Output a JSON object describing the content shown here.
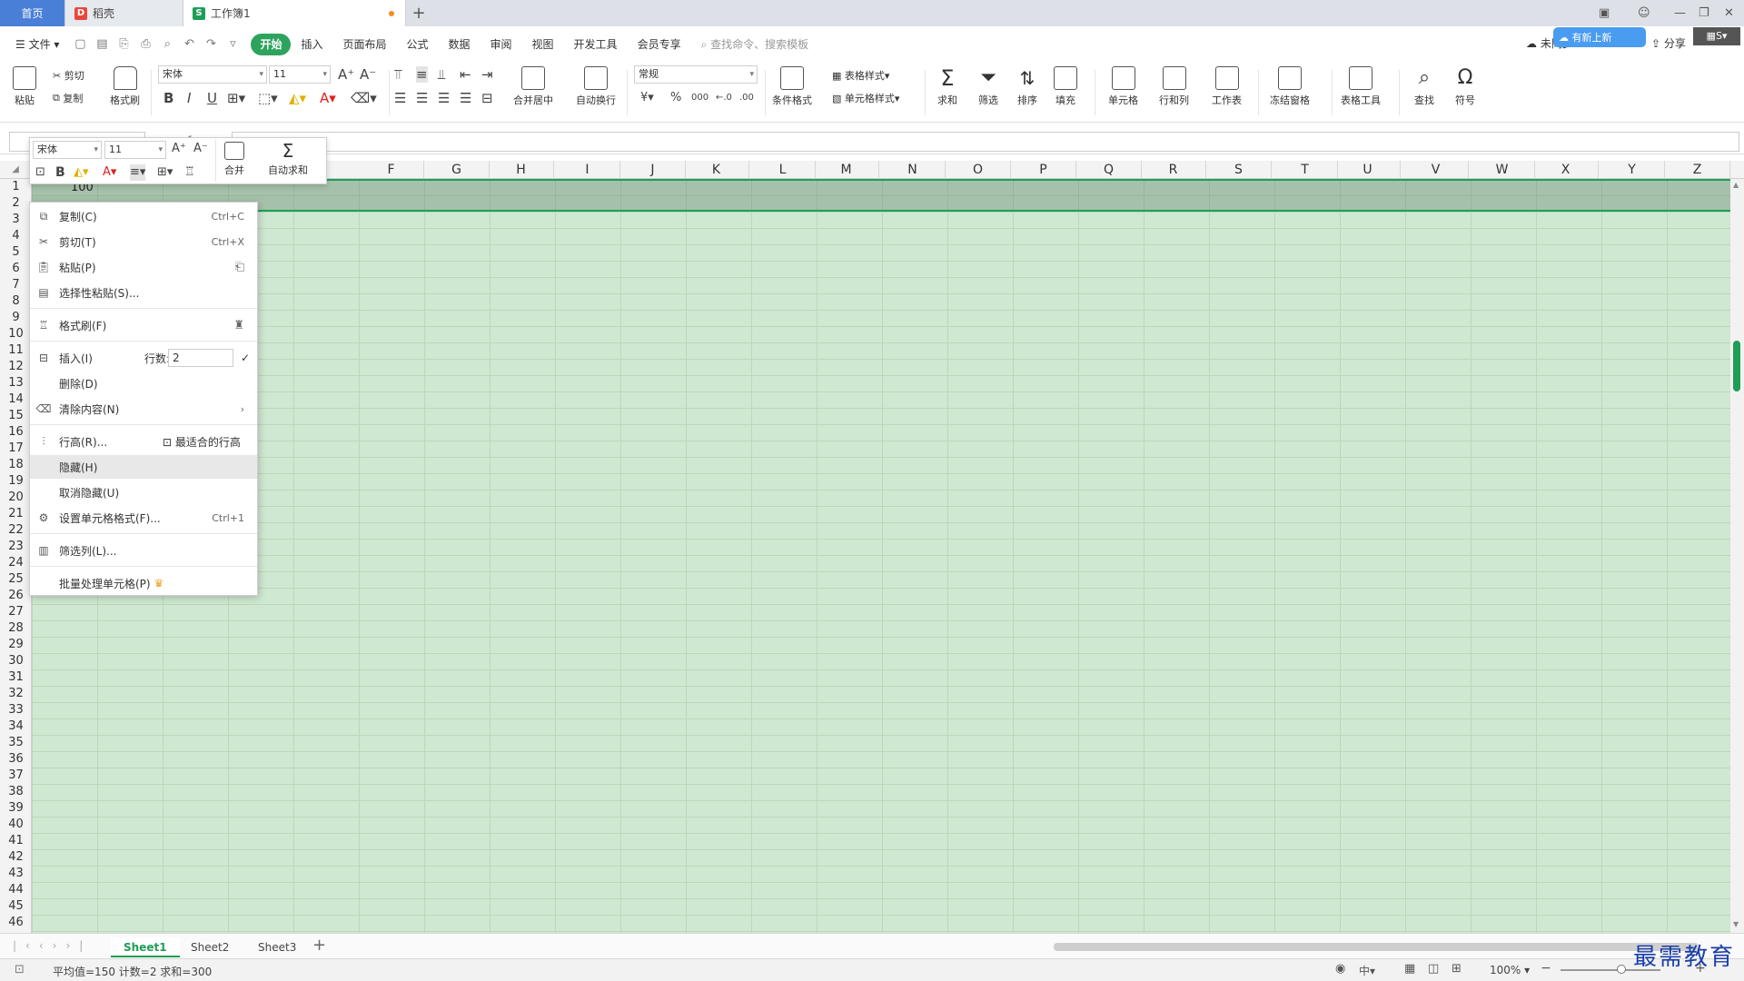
{
  "tabs": {
    "home": "首页",
    "daoke": "稻壳",
    "workbook": "工作簿1",
    "add": "+"
  },
  "menu": {
    "file": "文件",
    "items": [
      "开始",
      "插入",
      "页面布局",
      "公式",
      "数据",
      "审阅",
      "视图",
      "开发工具",
      "会员专享"
    ],
    "search_placeholder": "查找命令、搜索模板",
    "cloud": "未同步",
    "share": "分享",
    "cloud_badge": "有新上新"
  },
  "ribbon": {
    "paste": "粘贴",
    "cut": "剪切",
    "copy": "复制",
    "format_painter": "格式刷",
    "font": "宋体",
    "size": "11",
    "merge": "合并居中",
    "wrap": "自动换行",
    "number_format": "常规",
    "table_style": "表格样式",
    "cond_format": "条件格式",
    "cell_style": "单元格样式",
    "sum": "求和",
    "filter": "筛选",
    "sort": "排序",
    "fill": "填充",
    "cell": "单元格",
    "rowcol": "行和列",
    "sheet": "工作表",
    "freeze": "冻结窗格",
    "table_tools": "表格工具",
    "find": "查找",
    "symbol": "符号",
    "currency": "¥",
    "percent": "%",
    "thousands": "000"
  },
  "mini": {
    "font": "宋体",
    "size": "11",
    "merge": "合并",
    "autosum": "自动求和"
  },
  "columns": [
    "F",
    "G",
    "H",
    "I",
    "J",
    "K",
    "L",
    "M",
    "N",
    "O",
    "P",
    "Q",
    "R",
    "S",
    "T",
    "U",
    "V",
    "W",
    "X",
    "Y",
    "Z"
  ],
  "rows": [
    "1",
    "2",
    "3",
    "4",
    "5",
    "6",
    "7",
    "8",
    "9",
    "10",
    "11",
    "12",
    "13",
    "14",
    "15",
    "16",
    "17",
    "18",
    "19",
    "20",
    "21",
    "22",
    "23",
    "24",
    "25",
    "26",
    "27",
    "28",
    "29",
    "30",
    "31",
    "32",
    "33",
    "34",
    "35",
    "36",
    "37",
    "38",
    "39",
    "40",
    "41",
    "42",
    "43",
    "44",
    "45",
    "46"
  ],
  "cells": {
    "a1": "100"
  },
  "context": {
    "copy": "复制(C)",
    "copy_sc": "Ctrl+C",
    "cut": "剪切(T)",
    "cut_sc": "Ctrl+X",
    "paste": "粘贴(P)",
    "paste_special": "选择性粘贴(S)...",
    "format_painter": "格式刷(F)",
    "insert": "插入(I)",
    "rows_label": "行数:",
    "rows_value": "2",
    "delete": "删除(D)",
    "clear": "清除内容(N)",
    "row_height": "行高(R)...",
    "best_height": "最适合的行高",
    "hide": "隐藏(H)",
    "unhide": "取消隐藏(U)",
    "format_cells": "设置单元格格式(F)...",
    "format_cells_sc": "Ctrl+1",
    "filter_col": "筛选列(L)...",
    "batch": "批量处理单元格(P)"
  },
  "sheets": [
    "Sheet1",
    "Sheet2",
    "Sheet3"
  ],
  "status": {
    "summary": "平均值=150  计数=2  求和=300",
    "zoom": "100%",
    "lang": "中"
  },
  "watermark": "最需教育"
}
